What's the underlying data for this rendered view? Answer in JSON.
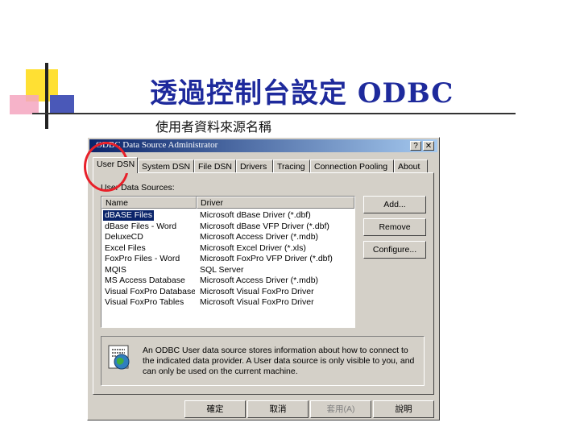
{
  "slide": {
    "title": "透過控制台設定 ODBC",
    "subtitle": "使用者資料來源名稱"
  },
  "dialog": {
    "title": "ODBC Data Source Administrator",
    "help_btn": "?",
    "close_btn": "✕",
    "tabs": [
      "User DSN",
      "System DSN",
      "File DSN",
      "Drivers",
      "Tracing",
      "Connection Pooling",
      "About"
    ],
    "group_label": "User Data Sources:",
    "columns": [
      "Name",
      "Driver"
    ],
    "rows": [
      {
        "name": "dBASE Files",
        "driver": "Microsoft dBase Driver (*.dbf)"
      },
      {
        "name": "dBase Files - Word",
        "driver": "Microsoft dBase VFP Driver (*.dbf)"
      },
      {
        "name": "DeluxeCD",
        "driver": "Microsoft Access Driver (*.mdb)"
      },
      {
        "name": "Excel Files",
        "driver": "Microsoft Excel Driver (*.xls)"
      },
      {
        "name": "FoxPro Files - Word",
        "driver": "Microsoft FoxPro VFP Driver (*.dbf)"
      },
      {
        "name": "MQIS",
        "driver": "SQL Server"
      },
      {
        "name": "MS Access Database",
        "driver": "Microsoft Access Driver (*.mdb)"
      },
      {
        "name": "Visual FoxPro Database",
        "driver": "Microsoft Visual FoxPro Driver"
      },
      {
        "name": "Visual FoxPro Tables",
        "driver": "Microsoft Visual FoxPro Driver"
      }
    ],
    "side_buttons": {
      "add": "Add...",
      "remove": "Remove",
      "configure": "Configure..."
    },
    "info_text": "An ODBC User data source stores information about how to connect to the indicated data provider.  A User data source is only visible to you, and can only be used on the current machine.",
    "footer_buttons": {
      "ok": "確定",
      "cancel": "取消",
      "apply": "套用(A)",
      "help": "說明"
    }
  },
  "colors": {
    "title_blue": "#1e2a9c",
    "highlight": "#e8202a",
    "selection": "#0a246a"
  }
}
